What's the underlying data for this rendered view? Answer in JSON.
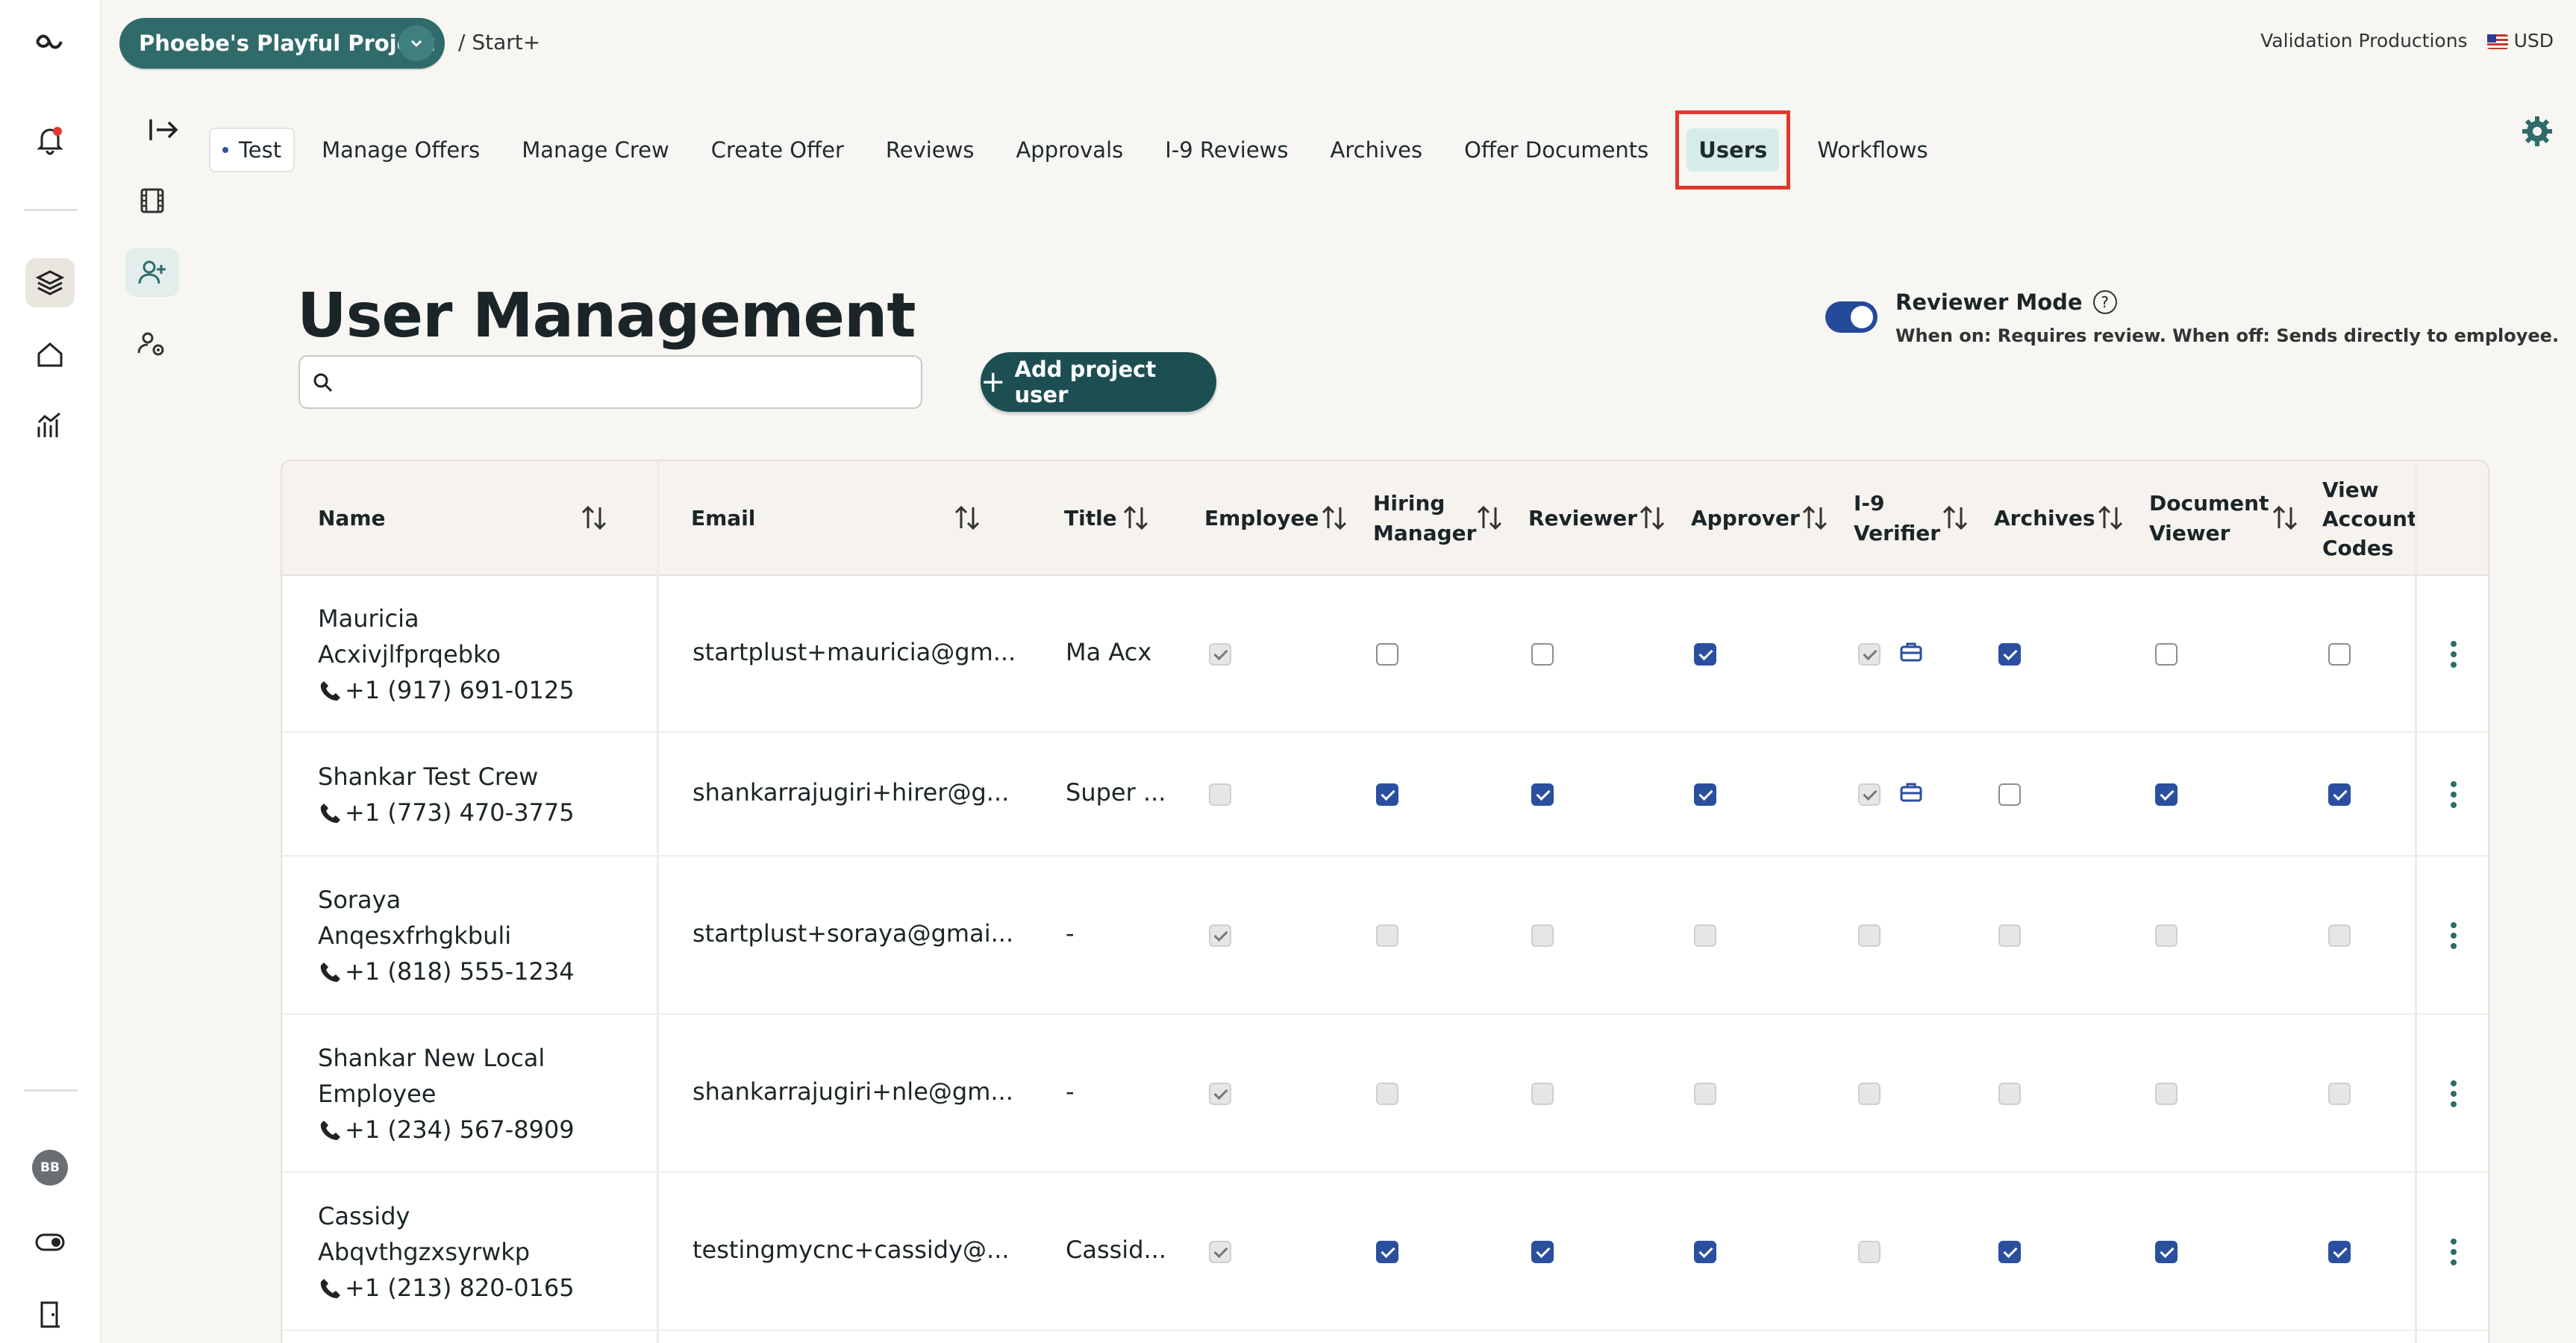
{
  "project": {
    "name": "Phoebe's Playful Project",
    "crumb": "/ Start+"
  },
  "header": {
    "company": "Validation Productions",
    "currency": "USD"
  },
  "rail": {
    "avatar": "BB"
  },
  "tabs": {
    "test": "Test",
    "items": [
      "Manage Offers",
      "Manage Crew",
      "Create Offer",
      "Reviews",
      "Approvals",
      "I-9 Reviews",
      "Archives",
      "Offer Documents"
    ],
    "users": "Users",
    "workflows": "Workflows"
  },
  "page": {
    "title": "User Management",
    "search_placeholder": "",
    "add_button": "Add project user",
    "reviewer_mode": {
      "title": "Reviewer Mode",
      "on": true,
      "description": "When on: Requires review. When off: Sends directly to employee."
    }
  },
  "table": {
    "headers": {
      "name": "Name",
      "email": "Email",
      "title": "Title",
      "employee": "Employee",
      "hiring_manager": [
        "Hiring",
        "Manager"
      ],
      "reviewer": "Reviewer",
      "approver": "Approver",
      "i9": [
        "I-9",
        "Verifier"
      ],
      "archives": "Archives",
      "document_viewer": [
        "Document",
        "Viewer"
      ],
      "view_account_codes": [
        "View",
        "Account",
        "Codes"
      ]
    },
    "rows": [
      {
        "name_lines": [
          "Mauricia",
          "Acxivjlfprqebko"
        ],
        "phone": "+1 (917) 691-0125",
        "email": "startplust+mauricia@gm...",
        "title": "Ma Acx",
        "checks": [
          "dison",
          "off",
          "off",
          "on",
          "dison",
          "on",
          "off",
          "off"
        ],
        "i9_badge": true
      },
      {
        "name_lines": [
          "Shankar Test Crew"
        ],
        "phone": "+1 (773) 470-3775",
        "email": "shankarrajugiri+hirer@g...",
        "title": "Super ...",
        "checks": [
          "dis",
          "on",
          "on",
          "on",
          "dison",
          "off",
          "on",
          "on"
        ],
        "i9_badge": true
      },
      {
        "name_lines": [
          "Soraya",
          "Anqesxfrhgkbuli"
        ],
        "phone": "+1 (818) 555-1234",
        "email": "startplust+soraya@gmai...",
        "title": "-",
        "checks": [
          "dison",
          "dis",
          "dis",
          "dis",
          "dis",
          "dis",
          "dis",
          "dis"
        ],
        "i9_badge": false
      },
      {
        "name_lines": [
          "Shankar New Local",
          "Employee"
        ],
        "phone": "+1 (234) 567-8909",
        "email": "shankarrajugiri+nle@gm...",
        "title": "-",
        "checks": [
          "dison",
          "dis",
          "dis",
          "dis",
          "dis",
          "dis",
          "dis",
          "dis"
        ],
        "i9_badge": false
      },
      {
        "name_lines": [
          "Cassidy",
          "Abqvthgzxsyrwkp"
        ],
        "phone": "+1 (213) 820-0165",
        "email": "testingmycnc+cassidy@...",
        "title": "Cassid...",
        "checks": [
          "dison",
          "on",
          "on",
          "on",
          "dis",
          "on",
          "on",
          "on"
        ],
        "i9_badge": false
      }
    ]
  }
}
